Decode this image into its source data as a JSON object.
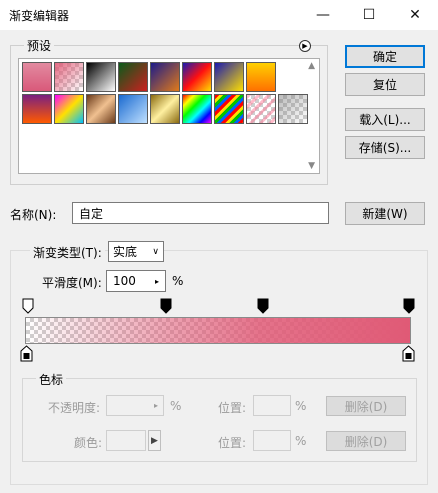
{
  "window": {
    "title": "渐变编辑器",
    "controls": [
      "—",
      "☐",
      "✕"
    ]
  },
  "presets": {
    "label": "预设"
  },
  "buttons": {
    "ok": "确定",
    "reset": "复位",
    "load": "载入(L)...",
    "save": "存储(S)...",
    "new": "新建(W)"
  },
  "name": {
    "label": "名称(N):",
    "value": "自定"
  },
  "gradient": {
    "type_label": "渐变类型(T):",
    "type_value": "实底",
    "smooth_label": "平滑度(M):",
    "smooth_value": "100",
    "smooth_unit": "%",
    "color": "#e05a76"
  },
  "color_stops": {
    "label": "色标",
    "opacity_label": "不透明度:",
    "opacity_unit": "%",
    "location_label_1": "位置:",
    "location_unit_1": "%",
    "delete_label_1": "删除(D)",
    "color_label": "颜色:",
    "location_label_2": "位置:",
    "location_unit_2": "%",
    "delete_label_2": "删除(D)"
  }
}
